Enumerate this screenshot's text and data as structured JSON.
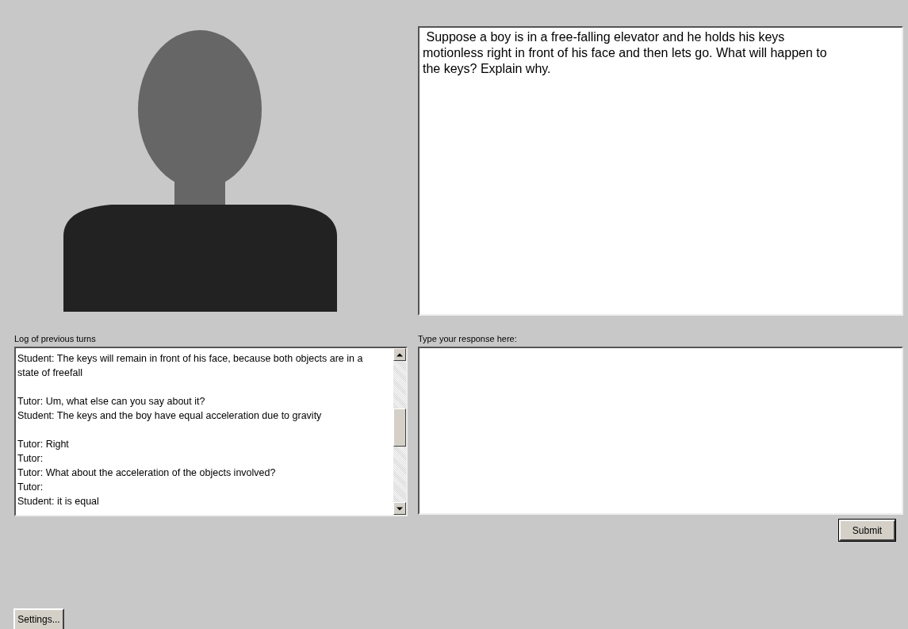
{
  "question": {
    "text": " Suppose a boy is in a free-falling elevator and he holds his keys motionless right in front of his face and then lets go. What will happen to the keys? Explain why."
  },
  "log": {
    "label": "Log of previous turns",
    "turns": [
      {
        "lines": [
          "Student: The keys will remain in front of his face, because both objects are in a state of freefall"
        ]
      },
      {
        "lines": [
          "Tutor: Um, what else can you say about it?",
          "Student: The keys and the boy have equal acceleration due to gravity"
        ]
      },
      {
        "lines": [
          "Tutor: Right",
          "Tutor:",
          "Tutor: What about the acceleration of the objects involved?",
          "Tutor:",
          "Student: it is equal"
        ]
      }
    ]
  },
  "response": {
    "label": "Type your response here:"
  },
  "buttons": {
    "submit": "Submit",
    "settings": "Settings..."
  }
}
